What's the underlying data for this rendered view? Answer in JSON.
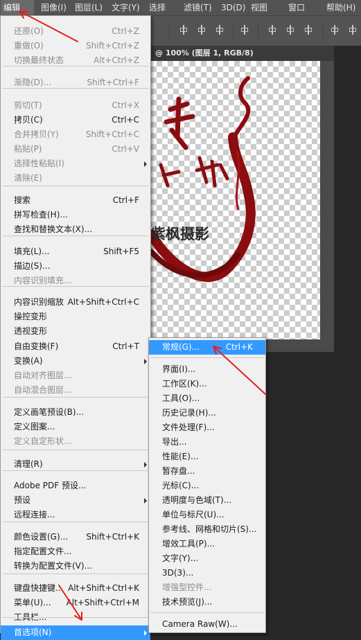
{
  "menubar": {
    "items": [
      "编辑(E)",
      "图像(I)",
      "图层(L)",
      "文字(Y)",
      "选择(S)",
      "滤镜(T)",
      "3D(D)",
      "视图(V)",
      "窗口(W)",
      "帮助(H)"
    ]
  },
  "document": {
    "tab_title": "@ 100% (图层 1, RGB/8)",
    "logo_text": "紫枫摄影"
  },
  "edit_menu": {
    "items": [
      {
        "label": "还原(O)",
        "shortcut": "Ctrl+Z",
        "disabled": true
      },
      {
        "label": "重做(O)",
        "shortcut": "Shift+Ctrl+Z",
        "disabled": true
      },
      {
        "label": "切换最终状态",
        "shortcut": "Alt+Ctrl+Z",
        "disabled": true
      },
      {
        "label": "渐隐(D)...",
        "shortcut": "Shift+Ctrl+F",
        "disabled": true
      },
      {
        "label": "剪切(T)",
        "shortcut": "Ctrl+X",
        "disabled": true
      },
      {
        "label": "拷贝(C)",
        "shortcut": "Ctrl+C",
        "disabled": false
      },
      {
        "label": "合并拷贝(Y)",
        "shortcut": "Shift+Ctrl+C",
        "disabled": true
      },
      {
        "label": "粘贴(P)",
        "shortcut": "Ctrl+V",
        "disabled": true
      },
      {
        "label": "选择性粘贴(I)",
        "shortcut": "",
        "disabled": true
      },
      {
        "label": "清除(E)",
        "shortcut": "",
        "disabled": true
      },
      {
        "label": "搜索",
        "shortcut": "Ctrl+F",
        "disabled": false
      },
      {
        "label": "拼写检查(H)...",
        "shortcut": "",
        "disabled": false
      },
      {
        "label": "查找和替换文本(X)...",
        "shortcut": "",
        "disabled": false
      },
      {
        "label": "填充(L)...",
        "shortcut": "Shift+F5",
        "disabled": false
      },
      {
        "label": "描边(S)...",
        "shortcut": "",
        "disabled": false
      },
      {
        "label": "内容识别填充...",
        "shortcut": "",
        "disabled": true
      },
      {
        "label": "内容识别缩放",
        "shortcut": "Alt+Shift+Ctrl+C",
        "disabled": false
      },
      {
        "label": "操控变形",
        "shortcut": "",
        "disabled": false
      },
      {
        "label": "透视变形",
        "shortcut": "",
        "disabled": false
      },
      {
        "label": "自由变换(F)",
        "shortcut": "Ctrl+T",
        "disabled": false
      },
      {
        "label": "变换(A)",
        "shortcut": "",
        "disabled": false
      },
      {
        "label": "自动对齐图层...",
        "shortcut": "",
        "disabled": true
      },
      {
        "label": "自动混合图层...",
        "shortcut": "",
        "disabled": true
      },
      {
        "label": "定义画笔预设(B)...",
        "shortcut": "",
        "disabled": false
      },
      {
        "label": "定义图案...",
        "shortcut": "",
        "disabled": false
      },
      {
        "label": "定义自定形状...",
        "shortcut": "",
        "disabled": true
      },
      {
        "label": "清理(R)",
        "shortcut": "",
        "disabled": false
      },
      {
        "label": "Adobe PDF 预设...",
        "shortcut": "",
        "disabled": false
      },
      {
        "label": "预设",
        "shortcut": "",
        "disabled": false
      },
      {
        "label": "远程连接...",
        "shortcut": "",
        "disabled": false
      },
      {
        "label": "颜色设置(G)...",
        "shortcut": "Shift+Ctrl+K",
        "disabled": false
      },
      {
        "label": "指定配置文件...",
        "shortcut": "",
        "disabled": false
      },
      {
        "label": "转换为配置文件(V)...",
        "shortcut": "",
        "disabled": false
      },
      {
        "label": "键盘快捷键...",
        "shortcut": "Alt+Shift+Ctrl+K",
        "disabled": false
      },
      {
        "label": "菜单(U)...",
        "shortcut": "Alt+Shift+Ctrl+M",
        "disabled": false
      },
      {
        "label": "工具栏...",
        "shortcut": "",
        "disabled": false
      },
      {
        "label": "首选项(N)",
        "shortcut": "",
        "disabled": false
      }
    ]
  },
  "prefs_submenu": {
    "items": [
      {
        "label": "常规(G)...",
        "shortcut": "Ctrl+K",
        "disabled": false
      },
      {
        "label": "界面(I)...",
        "shortcut": "",
        "disabled": false
      },
      {
        "label": "工作区(K)...",
        "shortcut": "",
        "disabled": false
      },
      {
        "label": "工具(O)...",
        "shortcut": "",
        "disabled": false
      },
      {
        "label": "历史记录(H)...",
        "shortcut": "",
        "disabled": false
      },
      {
        "label": "文件处理(F)...",
        "shortcut": "",
        "disabled": false
      },
      {
        "label": "导出...",
        "shortcut": "",
        "disabled": false
      },
      {
        "label": "性能(E)...",
        "shortcut": "",
        "disabled": false
      },
      {
        "label": "暂存盘...",
        "shortcut": "",
        "disabled": false
      },
      {
        "label": "光标(C)...",
        "shortcut": "",
        "disabled": false
      },
      {
        "label": "透明度与色域(T)...",
        "shortcut": "",
        "disabled": false
      },
      {
        "label": "单位与标尺(U)...",
        "shortcut": "",
        "disabled": false
      },
      {
        "label": "参考线、网格和切片(S)...",
        "shortcut": "",
        "disabled": false
      },
      {
        "label": "增效工具(P)...",
        "shortcut": "",
        "disabled": false
      },
      {
        "label": "文字(Y)...",
        "shortcut": "",
        "disabled": false
      },
      {
        "label": "3D(3)...",
        "shortcut": "",
        "disabled": false
      },
      {
        "label": "增强型控件...",
        "shortcut": "",
        "disabled": true
      },
      {
        "label": "技术预览(J)...",
        "shortcut": "",
        "disabled": false
      },
      {
        "label": "Camera Raw(W)...",
        "shortcut": "",
        "disabled": false
      }
    ]
  },
  "colors": {
    "highlight": "#3399ff",
    "arrow": "#e02020",
    "logo": "#8b0d10"
  }
}
